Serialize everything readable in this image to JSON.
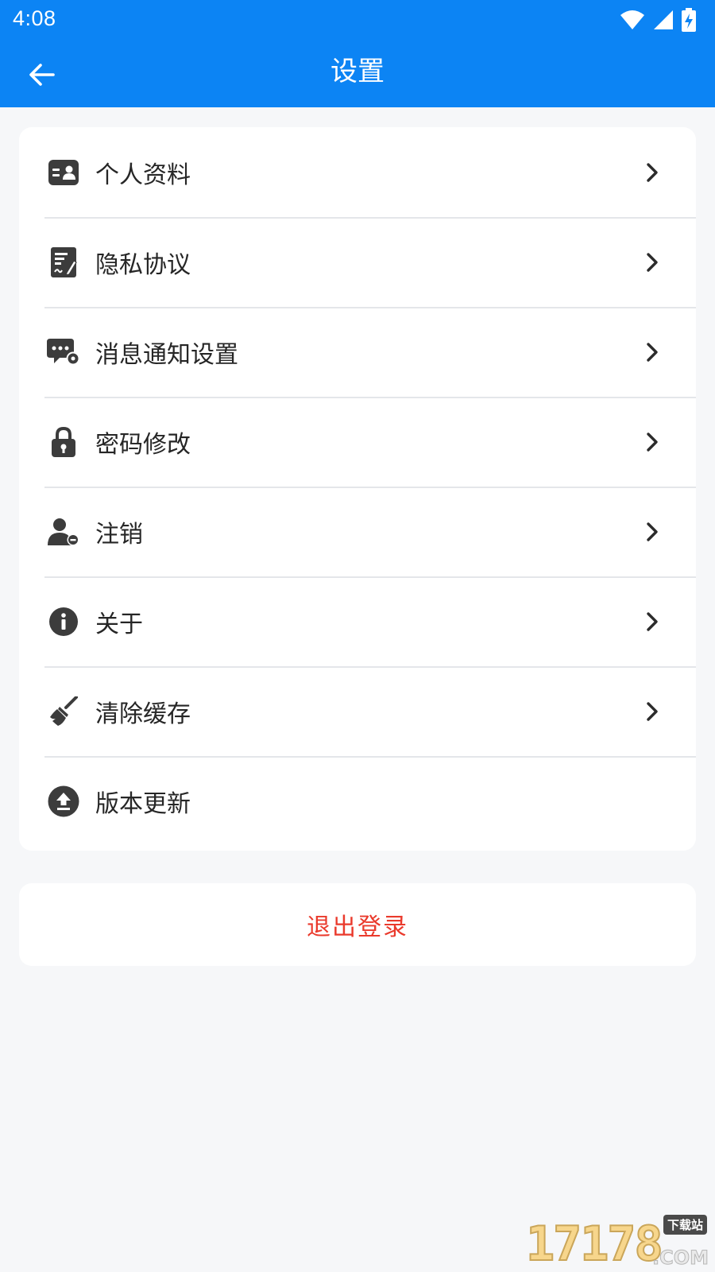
{
  "status_bar": {
    "time": "4:08"
  },
  "app_bar": {
    "title": "设置"
  },
  "menu": {
    "items": [
      {
        "label": "个人资料",
        "icon": "id-card-icon",
        "has_chevron": true
      },
      {
        "label": "隐私协议",
        "icon": "signed-document-icon",
        "has_chevron": true
      },
      {
        "label": "消息通知设置",
        "icon": "message-settings-icon",
        "has_chevron": true
      },
      {
        "label": "密码修改",
        "icon": "lock-icon",
        "has_chevron": true
      },
      {
        "label": "注销",
        "icon": "user-remove-icon",
        "has_chevron": true
      },
      {
        "label": "关于",
        "icon": "info-icon",
        "has_chevron": true
      },
      {
        "label": "清除缓存",
        "icon": "broom-icon",
        "has_chevron": true
      },
      {
        "label": "版本更新",
        "icon": "upload-icon",
        "has_chevron": false
      }
    ]
  },
  "logout": {
    "label": "退出登录"
  },
  "watermark": {
    "number": "17178",
    "domain": ".COM",
    "site": "下载站"
  },
  "colors": {
    "app_bar": "#0c84f4",
    "background": "#f6f7f9",
    "icon": "#3c3c3c",
    "logout": "#ea3a2c"
  }
}
